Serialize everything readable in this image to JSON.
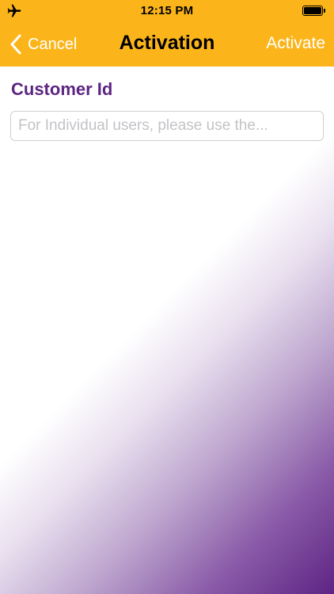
{
  "status_bar": {
    "time": "12:15 PM",
    "left_icon": "airplane-icon",
    "right_icon": "battery-icon"
  },
  "nav": {
    "back_label": "Cancel",
    "title": "Activation",
    "action_label": "Activate",
    "back_icon": "chevron-left-icon"
  },
  "form": {
    "customer_id": {
      "label": "Customer Id",
      "value": "",
      "placeholder": "For Individual users, please use the..."
    }
  },
  "colors": {
    "nav_background": "#fbb51b",
    "label_purple": "#5c2582",
    "gradient_purple": "#5e2484",
    "nav_text_white": "#ffffff"
  }
}
